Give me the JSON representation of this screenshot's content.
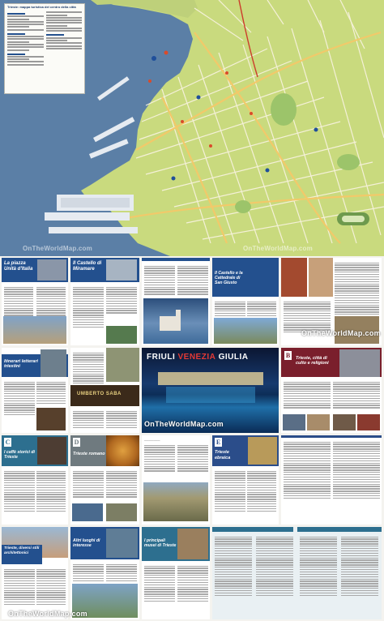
{
  "map": {
    "legend_title": "Trieste: mappa turistica del centro della città",
    "watermark": "OnTheWorldMap.com",
    "colors": {
      "sea": "#5b7fa6",
      "land": "#c9da7e",
      "roads": "#f7f2dd",
      "main_roads": "#f2c96a"
    }
  },
  "panels": {
    "piazza": {
      "title": "La piazza Unità d'Italia"
    },
    "miramare": {
      "title": "Il Castello di Miramare"
    },
    "castello": {
      "title": "Il Castello e la Cattedrale di San Giusto"
    },
    "itinerari": {
      "title": "Itinerari letterari triestini"
    },
    "citta": {
      "title": "Trieste, città di culto e religioni",
      "letter": "B"
    },
    "caffe": {
      "title": "I caffè storici di Trieste",
      "letter": "C"
    },
    "romano": {
      "title": "Trieste romano",
      "letter": "D"
    },
    "ebraica": {
      "title": "Trieste ebraica",
      "letter": "E"
    },
    "diversi": {
      "title": "Trieste, diversi stili architettonici"
    },
    "altri": {
      "title": "Altri luoghi di interesse"
    },
    "musei": {
      "title": "I principali musei di Trieste"
    }
  },
  "banner": {
    "brand_left": "FRIULI",
    "brand_mid": "VENEZIA",
    "brand_right": "GIULIA"
  },
  "sign_text": "UMBERTO SABA",
  "watermarks": [
    "OnTheWorldMap.com",
    "OnTheWorldMap.com",
    "OnTheWorldMap.com"
  ]
}
